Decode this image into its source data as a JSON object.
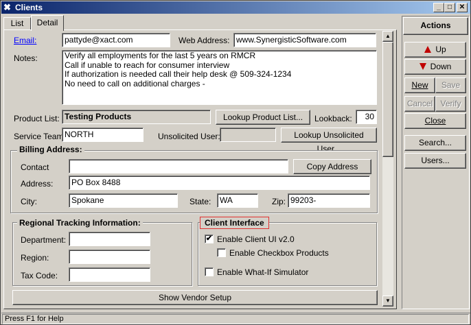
{
  "window": {
    "title": "Clients",
    "minimize": "_",
    "maximize": "□",
    "close": "✕"
  },
  "tabs": [
    {
      "label": "List"
    },
    {
      "label": "Detail"
    }
  ],
  "form": {
    "email_label": "Email:",
    "email_value": "pattyde@xact.com",
    "web_label": "Web Address:",
    "web_value": "www.SynergisticSoftware.com",
    "notes_label": "Notes:",
    "notes_lines": [
      "Verify all employments for the last 5 years on RMCR",
      "Call if unable to reach for consumer interview",
      "If authorization is needed call their help desk @ 509-324-1234",
      "No need to call on additional charges -"
    ],
    "product_label": "Product List:",
    "product_value": "Testing Products",
    "lookup_product_btn": "Lookup Product List...",
    "lookback_label": "Lookback:",
    "lookback_value": "30",
    "service_label": "Service Team:",
    "service_value": "NORTH",
    "unsolicited_label": "Unsolicited User:",
    "unsolicited_value": "",
    "lookup_unsolicited_btn": "Lookup Unsolicited User..."
  },
  "billing": {
    "title": "Billing Address:",
    "contact_label": "Contact",
    "contact_value": "",
    "copy_btn": "Copy Address",
    "address_label": "Address:",
    "address_value": "PO Box 8488",
    "city_label": "City:",
    "city_value": "Spokane",
    "state_label": "State:",
    "state_value": "WA",
    "zip_label": "Zip:",
    "zip_value": "99203-"
  },
  "regional": {
    "title": "Regional Tracking Information:",
    "department_label": "Department:",
    "department_value": "",
    "region_label": "Region:",
    "region_value": "",
    "taxcode_label": "Tax Code:",
    "taxcode_value": ""
  },
  "client_interface": {
    "title": "Client Interface",
    "enable_ui_label": "Enable Client UI v2.0",
    "enable_ui_checked": true,
    "enable_checkbox_label": "Enable Checkbox Products",
    "enable_checkbox_checked": false,
    "enable_whatif_label": "Enable What-If Simulator",
    "enable_whatif_checked": false
  },
  "show_vendor_btn": "Show Vendor Setup",
  "actions": {
    "title": "Actions",
    "up": "Up",
    "down": "Down",
    "new": "New",
    "save": "Save",
    "cancel": "Cancel",
    "verify": "Verify",
    "close": "Close",
    "search": "Search...",
    "users": "Users..."
  },
  "status": {
    "text": "Press F1 for Help"
  },
  "colors": {
    "title_start": "#0a246a",
    "title_end": "#a6caf0",
    "link": "#0000ff",
    "highlight": "#e03030",
    "arrow": "#c00000"
  }
}
